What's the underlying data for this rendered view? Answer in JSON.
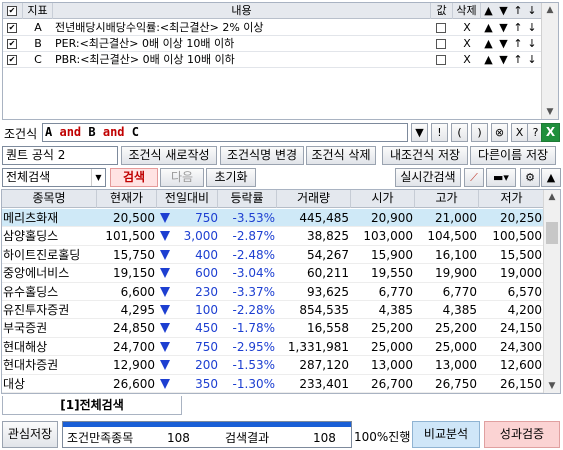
{
  "conditions": {
    "headers": [
      "지표",
      "내용",
      "값",
      "삭제"
    ],
    "rows": [
      {
        "checked": true,
        "id": "A",
        "desc": "전년배당시배당수익률:<최근결산> 2% 이상",
        "delete": "X"
      },
      {
        "checked": true,
        "id": "B",
        "desc": "PER:<최근결산> 0배 이상 10배 이하",
        "delete": "X"
      },
      {
        "checked": true,
        "id": "C",
        "desc": "PBR:<최근결산> 0배 이상 10배 이하",
        "delete": "X"
      }
    ],
    "move_labels": [
      "▲",
      "▼",
      "↑",
      "↓"
    ]
  },
  "expression": {
    "label": "조건식",
    "parts": [
      "A",
      "and",
      "B",
      "and",
      "C"
    ],
    "op_buttons": [
      "▼",
      "!",
      "(",
      ")",
      "⊗",
      "X",
      "?"
    ],
    "excel_label": "X"
  },
  "formula": {
    "name": "퀀트 공식 2",
    "buttons": [
      "조건식 새로작성",
      "조건식명 변경",
      "조건식 삭제",
      "내조건식 저장",
      "다른이름 저장"
    ]
  },
  "search": {
    "scope": "전체검색",
    "search_btn": "검색",
    "next_btn": "다음",
    "reset_btn": "초기화",
    "realtime_btn": "실시간검색"
  },
  "grid": {
    "headers": [
      "종목명",
      "현재가",
      "전일대비",
      "등락률",
      "거래량",
      "시가",
      "고가",
      "저가"
    ],
    "rows": [
      [
        "메리츠화재",
        "20,500",
        "750",
        "-3.53%",
        "445,485",
        "20,900",
        "21,000",
        "20,250"
      ],
      [
        "삼양홀딩스",
        "101,500",
        "3,000",
        "-2.87%",
        "38,825",
        "103,000",
        "104,500",
        "100,500"
      ],
      [
        "하이트진로홀딩",
        "15,750",
        "400",
        "-2.48%",
        "54,267",
        "15,900",
        "16,100",
        "15,500"
      ],
      [
        "중앙에너비스",
        "19,150",
        "600",
        "-3.04%",
        "60,211",
        "19,550",
        "19,900",
        "19,000"
      ],
      [
        "유수홀딩스",
        "6,600",
        "230",
        "-3.37%",
        "93,625",
        "6,770",
        "6,770",
        "6,570"
      ],
      [
        "유진투자증권",
        "4,295",
        "100",
        "-2.28%",
        "854,535",
        "4,385",
        "4,385",
        "4,200"
      ],
      [
        "부국증권",
        "24,850",
        "450",
        "-1.78%",
        "16,558",
        "25,200",
        "25,200",
        "24,150"
      ],
      [
        "현대해상",
        "24,700",
        "750",
        "-2.95%",
        "1,331,981",
        "25,000",
        "25,000",
        "24,300"
      ],
      [
        "현대차증권",
        "12,900",
        "200",
        "-1.53%",
        "287,120",
        "13,000",
        "13,000",
        "12,600"
      ],
      [
        "대상",
        "26,600",
        "350",
        "-1.30%",
        "233,401",
        "26,700",
        "26,750",
        "26,150"
      ]
    ]
  },
  "tab": {
    "label": "[1]전체검색"
  },
  "status": {
    "save_btn": "관심저장",
    "match_label": "조건만족종목",
    "match_count": "108",
    "result_label": "검색결과",
    "result_count": "108",
    "progress_text": "100%진행",
    "progress_fraction": 1.0,
    "compare_btn": "비교분석",
    "verify_btn": "성과검증"
  },
  "colors": {
    "down": "#1d3fd1",
    "keyword": "#c00000",
    "selected_row": "#cfe9f7",
    "progress": "#1a5fd6"
  }
}
